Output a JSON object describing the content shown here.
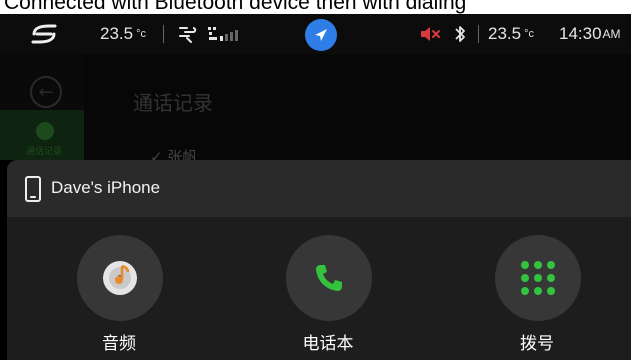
{
  "caption": "Connected with Bluetooth device then with dialing",
  "statusbar": {
    "temp_left": "23.5",
    "unit_left": "°c",
    "temp_right": "23.5",
    "unit_right": "°c",
    "time": "14:30",
    "ampm": "AM",
    "icons": [
      "car-logo-icon",
      "fan-icon",
      "signal-icon",
      "navigation-icon",
      "mute-icon",
      "bluetooth-icon"
    ],
    "colors": {
      "accent_blue": "#2f7de6",
      "mute_red": "#d63a3a"
    }
  },
  "background": {
    "title": "通话记录",
    "tab_label": "通话记录",
    "row_text": "✓ 张帆"
  },
  "popup": {
    "device_name": "Dave's iPhone",
    "actions": [
      {
        "label": "音频",
        "icon": "music-disc-icon"
      },
      {
        "label": "电话本",
        "icon": "phone-handset-icon"
      },
      {
        "label": "拨号",
        "icon": "dialpad-icon"
      }
    ],
    "colors": {
      "green": "#34c33f",
      "orange": "#e8892a"
    }
  }
}
